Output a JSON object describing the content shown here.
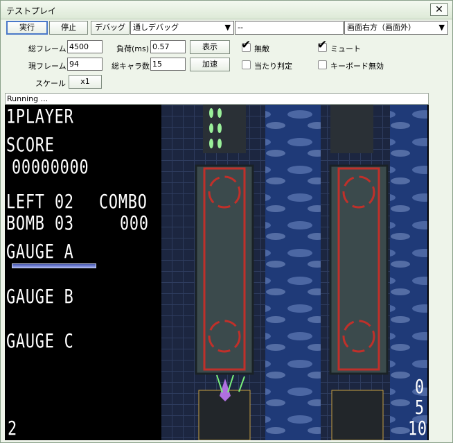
{
  "window": {
    "title": "テストプレイ",
    "close_glyph": "✕"
  },
  "toolbar": {
    "run_label": "実行",
    "stop_label": "停止",
    "debug_label": "デバッグ",
    "debug_mode": "通しデバッグ",
    "debug_target": "--",
    "display_position": "画面右方（画面外）",
    "dropdown_arrow": "▼"
  },
  "stats": {
    "total_frames_label": "総フレーム",
    "total_frames": "4500",
    "load_label": "負荷(ms)",
    "load": "0.57",
    "display_button": "表示",
    "current_frame_label": "現フレーム",
    "current_frame": "94",
    "total_chars_label": "総キャラ数",
    "total_chars": "15",
    "speedup_button": "加速",
    "scale_label": "スケール",
    "scale_value": "x1"
  },
  "options": {
    "invincible_label": "無敵",
    "invincible_checked": true,
    "mute_label": "ミュート",
    "mute_checked": true,
    "hitbox_label": "当たり判定",
    "hitbox_checked": false,
    "keyboard_disable_label": "キーボード無効",
    "keyboard_disable_checked": false,
    "check_glyph": "✔"
  },
  "status": {
    "text": "Running ..."
  },
  "hud": {
    "player": "1PLAYER",
    "score_label": "SCORE",
    "score": "00000000",
    "left_label": "LEFT",
    "left": "02",
    "combo_label": "COMBO",
    "bomb_label": "BOMB",
    "bomb": "03",
    "combo": "000",
    "gauge_a_label": "GAUGE A",
    "gauge_a_level": 1.0,
    "gauge_b_label": "GAUGE B",
    "gauge_c_label": "GAUGE C",
    "bottom_left": "2",
    "right_counters": [
      "0",
      "5",
      "10"
    ]
  }
}
